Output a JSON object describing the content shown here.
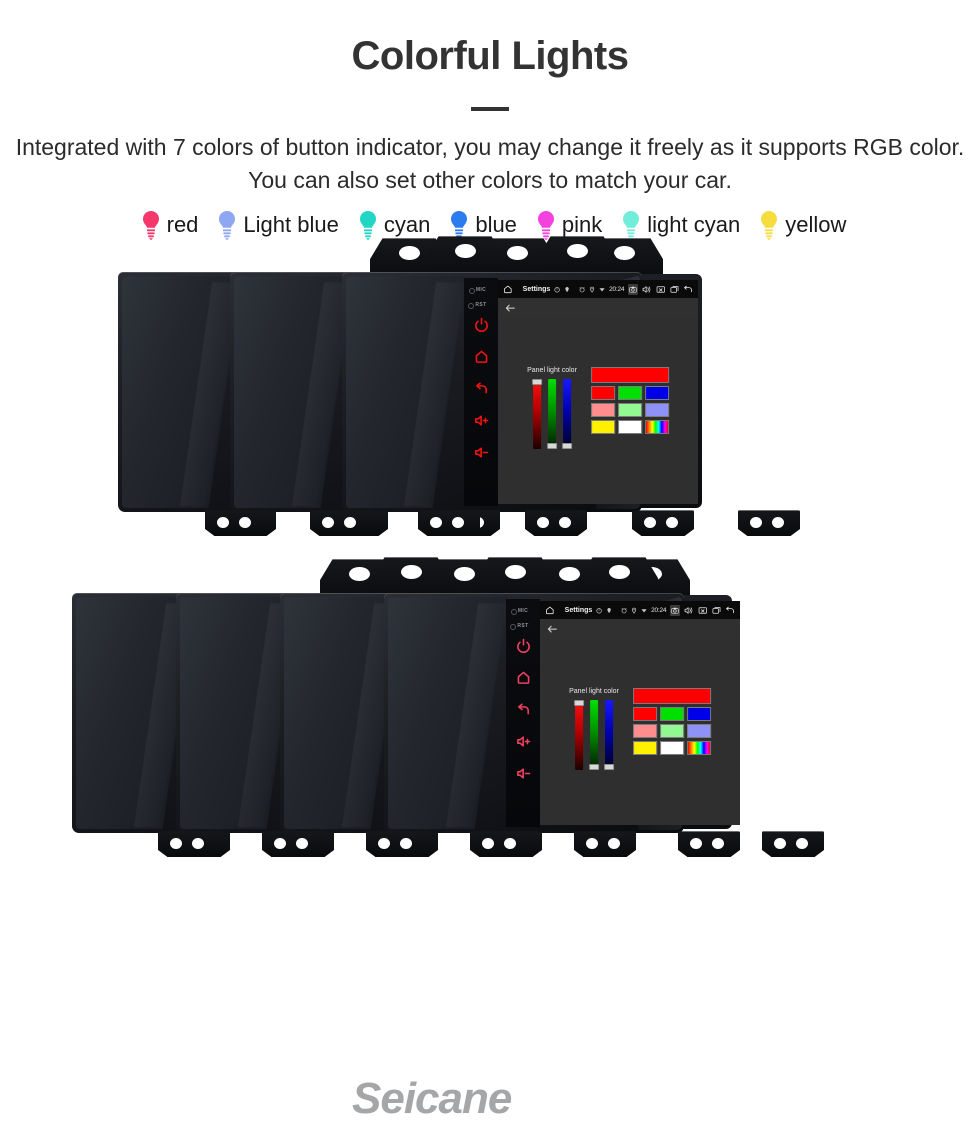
{
  "header": {
    "title": "Colorful Lights",
    "subtitle": "Integrated with 7 colors of button indicator, you may change it freely as it supports RGB color. You can also set other colors to match your car."
  },
  "legend": {
    "items": [
      {
        "label": "red",
        "color": "#F5376B",
        "icon": "bulb-icon"
      },
      {
        "label": "Light blue",
        "color": "#8FA6F2",
        "icon": "bulb-icon"
      },
      {
        "label": "cyan",
        "color": "#22D6C6",
        "icon": "bulb-icon"
      },
      {
        "label": "blue",
        "color": "#2C7BEF",
        "icon": "bulb-icon"
      },
      {
        "label": "pink",
        "color": "#F441E0",
        "icon": "bulb-icon"
      },
      {
        "label": "light cyan",
        "color": "#72EDD9",
        "icon": "bulb-icon"
      },
      {
        "label": "yellow",
        "color": "#F4DD3C",
        "icon": "bulb-icon"
      }
    ]
  },
  "device": {
    "keypad": {
      "mic_label": "MIC",
      "reset_label": "RST",
      "buttons": [
        {
          "name": "power-icon"
        },
        {
          "name": "home-icon"
        },
        {
          "name": "back-icon"
        },
        {
          "name": "volume-up-icon"
        },
        {
          "name": "volume-down-icon"
        }
      ]
    },
    "statusbar": {
      "home_icon": "home-icon",
      "title": "Settings",
      "left_icons": [
        "timer-icon",
        "gps-pin-icon"
      ],
      "right_icons": [
        "alarm-icon",
        "location-icon",
        "wifi-icon"
      ],
      "clock": "20:24",
      "buttons": [
        "camera-icon",
        "volume-icon",
        "close-icon",
        "recent-apps-icon",
        "back-icon"
      ]
    },
    "actionbar": {
      "back_icon": "arrow-back-icon"
    },
    "dialog": {
      "title": "Panel light color",
      "sliders": [
        {
          "name": "red-slider",
          "thumb": "top"
        },
        {
          "name": "green-slider",
          "thumb": "bottom"
        },
        {
          "name": "blue-slider",
          "thumb": "bottom"
        }
      ],
      "preview_color": "#FF0000",
      "swatch_rows": [
        [
          "#FF0000",
          "#00E000",
          "#0000E8"
        ],
        [
          "#FF8D8D",
          "#92F992",
          "#8E92F7"
        ],
        [
          "#FFF000",
          "#FFFFFF",
          "rainbow"
        ]
      ]
    }
  },
  "groups": {
    "top": {
      "units": [
        {
          "led_color": "#1414F0",
          "name": "unit-blue"
        },
        {
          "led_color": "#18E018",
          "name": "unit-green"
        },
        {
          "led_color": "#F01414",
          "name": "unit-red"
        }
      ]
    },
    "bottom": {
      "units": [
        {
          "led_color": "#F0D014",
          "name": "unit-yellow"
        },
        {
          "led_color": "#7A3CF0",
          "name": "unit-violet"
        },
        {
          "led_color": "#18E018",
          "name": "unit-green"
        },
        {
          "led_color": "#F04060",
          "name": "unit-pink"
        }
      ]
    }
  },
  "watermark": {
    "text": "Seicane"
  }
}
